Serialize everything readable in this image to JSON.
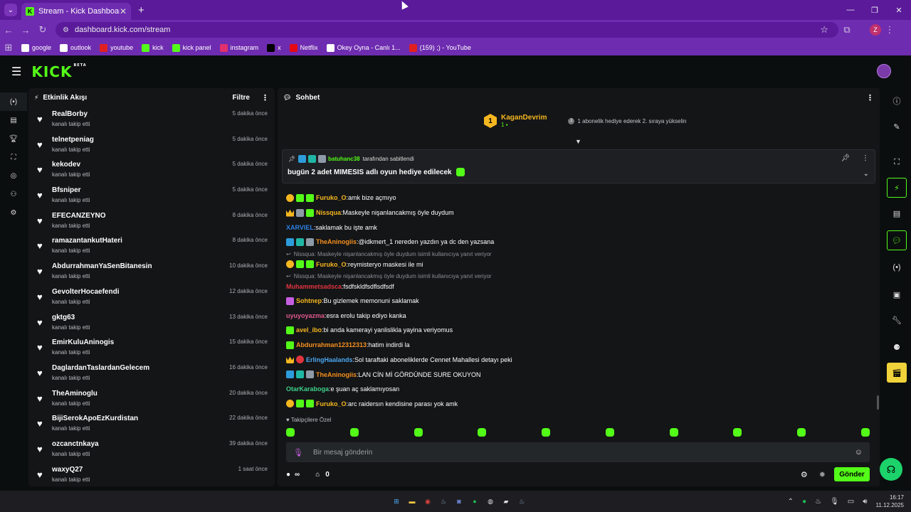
{
  "browser": {
    "tab_title": "Stream - Kick Dashboard",
    "tab_close": "✕",
    "new_tab": "+",
    "url": "dashboard.kick.com/stream",
    "profile_initial": "Z",
    "bookmarks": [
      {
        "label": "google",
        "icon": "google-icon",
        "color": "#ffffff"
      },
      {
        "label": "outlook",
        "icon": "outlook-icon",
        "color": "#ffffff"
      },
      {
        "label": "youtube",
        "icon": "youtube-icon",
        "color": "#e02020"
      },
      {
        "label": "kick",
        "icon": "kick-icon",
        "color": "#53fc18"
      },
      {
        "label": "kick panel",
        "icon": "kick-icon",
        "color": "#53fc18"
      },
      {
        "label": "instagram",
        "icon": "instagram-icon",
        "color": "#e1306c"
      },
      {
        "label": "x",
        "icon": "x-icon",
        "color": "#000000"
      },
      {
        "label": "Netflix",
        "icon": "netflix-icon",
        "color": "#e50914"
      },
      {
        "label": "Okey Oyna - Canlı 1...",
        "icon": "okey-icon",
        "color": "#ffffff"
      },
      {
        "label": "(159) ;) - YouTube",
        "icon": "youtube-icon",
        "color": "#e02020"
      }
    ]
  },
  "app": {
    "logo": "KICK",
    "beta": "BETA"
  },
  "activity": {
    "title": "Etkinlik Akışı",
    "filter": "Filtre",
    "items": [
      {
        "name": "RealBorby",
        "sub": "kanalı takip etti",
        "time": "5 dakika önce"
      },
      {
        "name": "telnetpeniag",
        "sub": "kanalı takip etti",
        "time": "5 dakika önce"
      },
      {
        "name": "kekodev",
        "sub": "kanalı takip etti",
        "time": "5 dakika önce"
      },
      {
        "name": "Bfsniper",
        "sub": "kanalı takip etti",
        "time": "5 dakika önce"
      },
      {
        "name": "EFECANZEYNO",
        "sub": "kanalı takip etti",
        "time": "8 dakika önce"
      },
      {
        "name": "ramazantankutHateri",
        "sub": "kanalı takip etti",
        "time": "8 dakika önce"
      },
      {
        "name": "AbdurrahmanYaSenBitanesin",
        "sub": "kanalı takip etti",
        "time": "10 dakika önce"
      },
      {
        "name": "GevolterHocaefendi",
        "sub": "kanalı takip etti",
        "time": "12 dakika önce"
      },
      {
        "name": "gktg63",
        "sub": "kanalı takip etti",
        "time": "13 dakika önce"
      },
      {
        "name": "EmirKuluAninogis",
        "sub": "kanalı takip etti",
        "time": "15 dakika önce"
      },
      {
        "name": "DaglardanTaslardanGelecem",
        "sub": "kanalı takip etti",
        "time": "16 dakika önce"
      },
      {
        "name": "TheAminoglu",
        "sub": "kanalı takip etti",
        "time": "20 dakika önce"
      },
      {
        "name": "BijiSerokApoEzKurdistan",
        "sub": "kanalı takip etti",
        "time": "22 dakika önce"
      },
      {
        "name": "ozcanctnkaya",
        "sub": "kanalı takip etti",
        "time": "39 dakika önce"
      },
      {
        "name": "waxyQ27",
        "sub": "kanalı takip etti",
        "time": "1 saat önce"
      }
    ]
  },
  "chat": {
    "title": "Sohbet",
    "top_sub": {
      "rank": "1",
      "name": "KaganDevrim",
      "count": "1",
      "note": "1 abonelik hediye ederek 2. sıraya yükselin"
    },
    "pinned": {
      "by_user": "batuhanc38",
      "by_suffix": "tarafından sabitlendi",
      "message": "bugün 2 adet MIMESIS adlı oyun hediye edilecek"
    },
    "messages": [
      {
        "badges": [
          "b-gold",
          "b-green",
          "b-green"
        ],
        "user": "Furuko_O",
        "color": "#f5b720",
        "text": "amk bize açmıyo"
      },
      {
        "badges": [
          "b-crown",
          "b-grey",
          "b-green"
        ],
        "user": "Nissqua",
        "color": "#f5b720",
        "text": "Maskeyle nişanlancakmış öyle duydum"
      },
      {
        "badges": [],
        "user": "XARVIEL",
        "color": "#2d7fe0",
        "text": "saklamak bu işte amk"
      },
      {
        "badges": [
          "b-blue",
          "b-teal",
          "b-grey"
        ],
        "user": "TheAninogiis",
        "color": "#f5901e",
        "text": "@idkmert_1 nereden yazdın ya dc den yazsana"
      },
      {
        "reply": "Nissqua: Maskeyle nişanlancakmış öyle duydum isimli kullanıcıya yanıt veriyor",
        "badges": [
          "b-gold",
          "b-green",
          "b-green"
        ],
        "user": "Furuko_O",
        "color": "#f5b720",
        "text": "reymisteryo maskesi ile mi"
      },
      {
        "reply": "Nissqua: Maskeyle nişanlancakmış öyle duydum isimli kullanıcıya yanıt veriyor",
        "badges": [],
        "user": "Muhammetsadsca",
        "color": "#e0343e",
        "text": "fsdfskldfsdflsdfsdf"
      },
      {
        "badges": [
          "b-pink"
        ],
        "user": "Sohtnep",
        "color": "#f5b720",
        "text": "Bu gizlemek memonuni saklamak"
      },
      {
        "badges": [],
        "user": "uyuyoyazma",
        "color": "#e05a8a",
        "text": "esra erolu takip ediyo kanka"
      },
      {
        "badges": [
          "b-green"
        ],
        "user": "avel_ibo",
        "color": "#f5b720",
        "text": "bi anda kamerayi yanlislikla yayina veriyomus"
      },
      {
        "badges": [
          "b-green"
        ],
        "user": "Abdurrahman12312313",
        "color": "#f5901e",
        "text": "hatim indirdi la"
      },
      {
        "badges": [
          "b-crown",
          "b-red"
        ],
        "user": "ErlingHaalands",
        "color": "#4aa8f0",
        "text": "Sol taraftaki aboneliklerde Cennet Mahallesi detayı peki"
      },
      {
        "badges": [
          "b-blue",
          "b-teal",
          "b-grey"
        ],
        "user": "TheAninogiis",
        "color": "#f5901e",
        "text": "LAN CİN Mİ GÖRDÜNDE SURE OKUYON"
      },
      {
        "badges": [],
        "user": "OtarKaraboga",
        "color": "#3ed18a",
        "text": "e şuan aç saklamıyosan"
      },
      {
        "badges": [
          "b-gold",
          "b-green",
          "b-green"
        ],
        "user": "Furuko_O",
        "color": "#f5b720",
        "text": "arc raidersın kendisine parası yok amk"
      }
    ],
    "followers_only": "Takipçilere Özel",
    "input_placeholder": "Bir mesaj gönderin",
    "points": "∞",
    "store_count": "0",
    "send": "Gönder"
  },
  "taskbar": {
    "time": "16:17",
    "date": "11.12.2025"
  }
}
